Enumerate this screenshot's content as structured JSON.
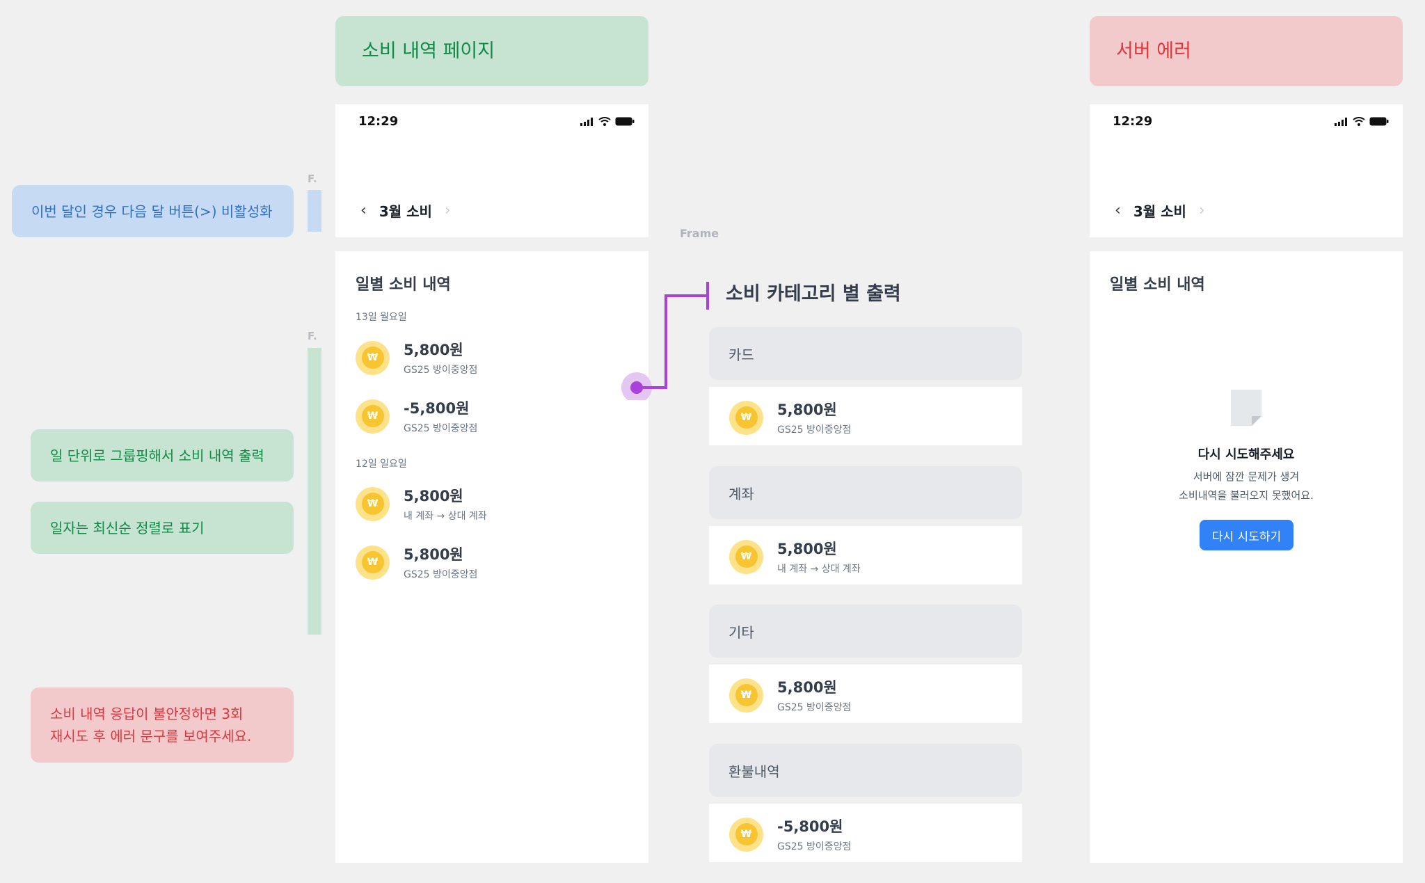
{
  "notes": {
    "disable_next": "이번 달인 경우 다음 달 버튼(>) 비활성화",
    "group_by_day": "일 단위로 그룹핑해서 소비 내역 출력",
    "sort_latest": "일자는 최신순 정렬로 표기",
    "retry_error_line1": "소비 내역 응답이 불안정하면 3회",
    "retry_error_line2": "재시도 후 에러 문구를 보여주세요."
  },
  "headers": {
    "history_page": "소비 내역 페이지",
    "server_error": "서버 에러"
  },
  "frame_markers": {
    "f1": "F.",
    "f2": "F.",
    "frame": "Frame"
  },
  "history": {
    "status_time": "12:29",
    "month": "3월 소비",
    "section_title": "일별 소비 내역",
    "days": [
      {
        "label": "13일 월요일",
        "items": [
          {
            "amount": "5,800원",
            "desc": "GS25 방이중앙점"
          },
          {
            "amount": "-5,800원",
            "desc": "GS25 방이중앙점"
          }
        ]
      },
      {
        "label": "12일 일요일",
        "items": [
          {
            "amount": "5,800원",
            "desc": "내 계좌 → 상대 계좌"
          },
          {
            "amount": "5,800원",
            "desc": "GS25 방이중앙점"
          }
        ]
      }
    ]
  },
  "categories": {
    "title": "소비 카테고리 별 출력",
    "groups": [
      {
        "name": "카드",
        "amount": "5,800원",
        "desc": "GS25 방이중앙점"
      },
      {
        "name": "계좌",
        "amount": "5,800원",
        "desc": "내 계좌 → 상대 계좌"
      },
      {
        "name": "기타",
        "amount": "5,800원",
        "desc": "GS25 방이중앙점"
      },
      {
        "name": "환불내역",
        "amount": "-5,800원",
        "desc": "GS25 방이중앙점"
      }
    ]
  },
  "error": {
    "status_time": "12:29",
    "month": "3월 소비",
    "section_title": "일별 소비 내역",
    "title": "다시 시도해주세요",
    "message_line1": "서버에 잠깐 문제가 생겨",
    "message_line2": "소비내역을 불러오지 못했어요.",
    "retry_button": "다시 시도하기"
  },
  "icons": {
    "coin": "won-coin-icon",
    "document": "document-icon",
    "back": "chevron-left-icon",
    "next": "chevron-right-icon"
  },
  "colors": {
    "primary_blue": "#3182f6",
    "coin_yellow": "#f7c531",
    "connector_purple": "#a942d8"
  }
}
